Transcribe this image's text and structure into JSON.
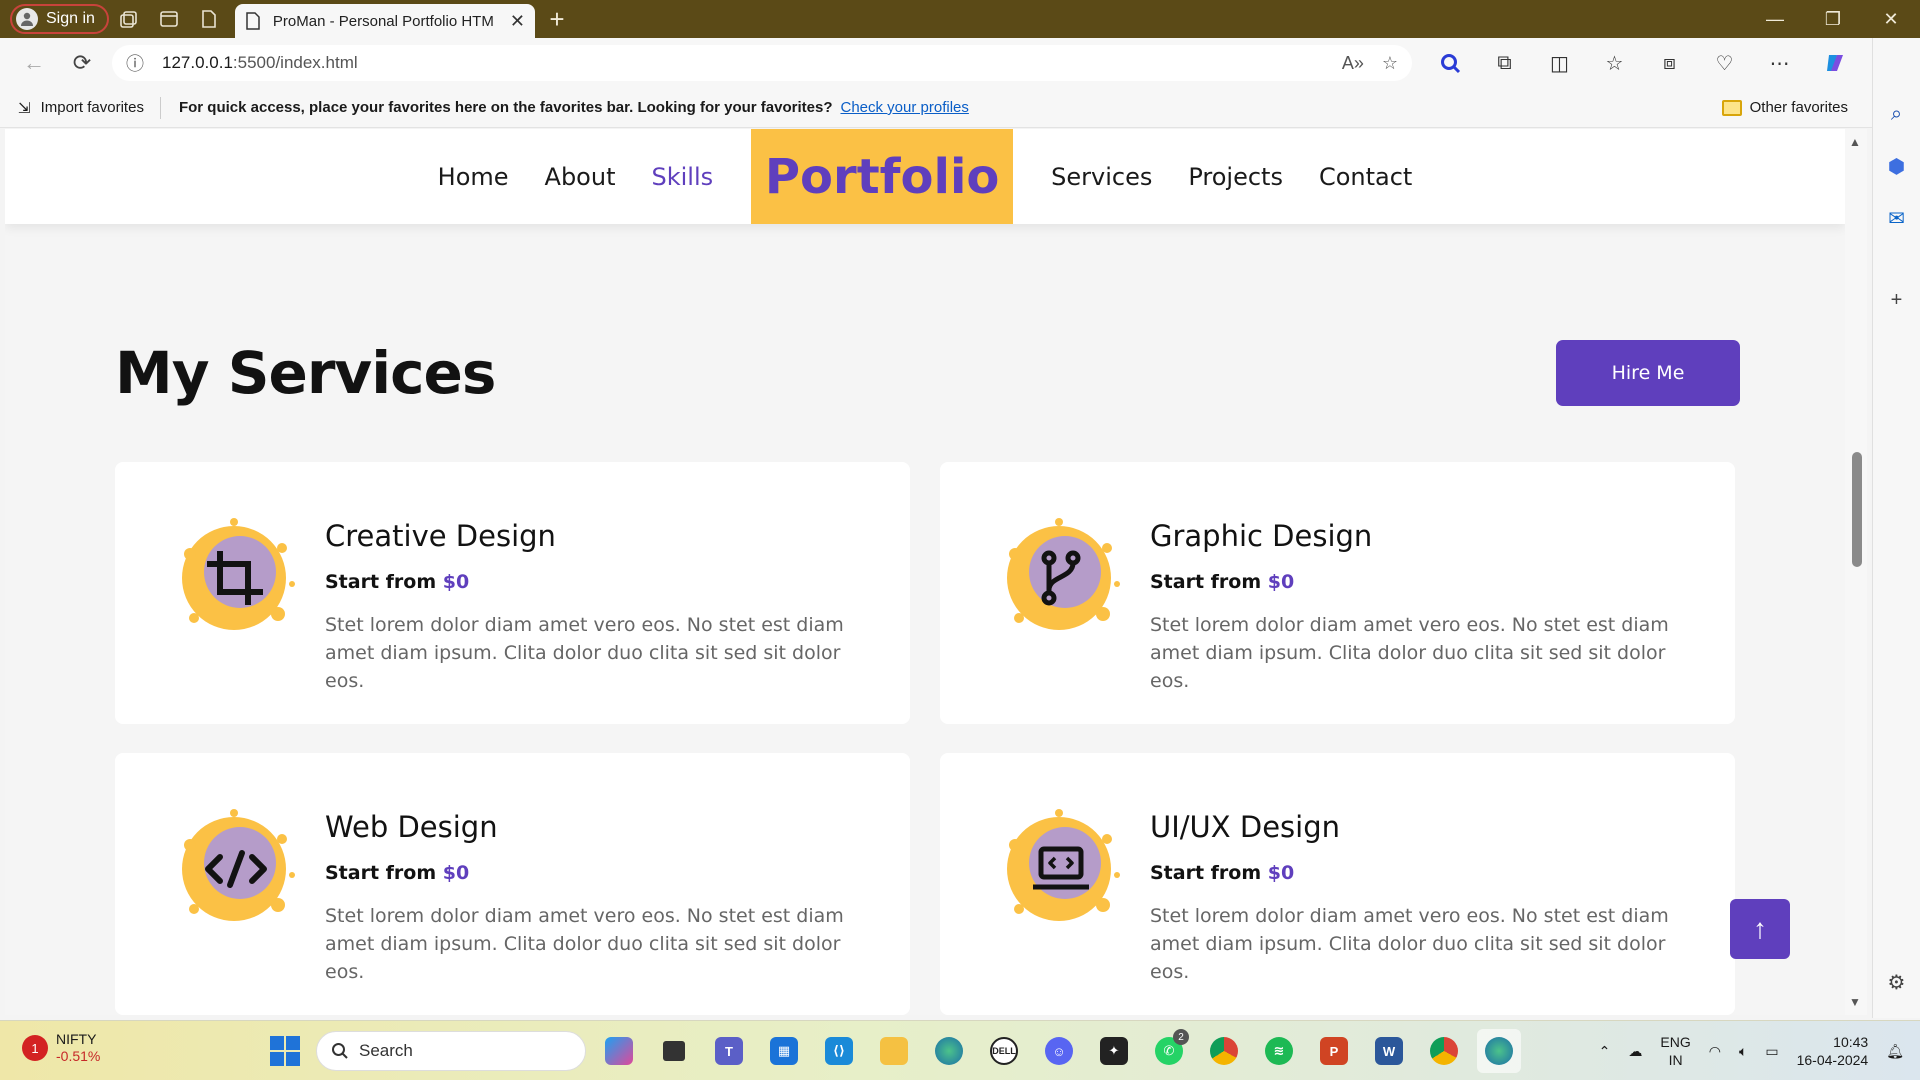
{
  "browser": {
    "signin_label": "Sign in",
    "tab_title": "ProMan - Personal Portfolio HTM",
    "url_host": "127.0.0.1",
    "url_path": ":5500/index.html",
    "favorites_import": "Import favorites",
    "favorites_message": "For quick access, place your favorites here on the favorites bar. Looking for your favorites?",
    "favorites_link": "Check your profiles",
    "favorites_other": "Other favorites"
  },
  "site": {
    "nav_left": [
      "Home",
      "About",
      "Skills"
    ],
    "brand": "Portfolio",
    "nav_right": [
      "Services",
      "Projects",
      "Contact"
    ],
    "active_nav": "Skills"
  },
  "services": {
    "title": "My Services",
    "hire_label": "Hire Me",
    "price_prefix": "Start from",
    "items": [
      {
        "title": "Creative Design",
        "price": "$0",
        "icon": "crop-icon",
        "desc": "Stet lorem dolor diam amet vero eos. No stet est diam amet diam ipsum. Clita dolor duo clita sit sed sit dolor eos."
      },
      {
        "title": "Graphic Design",
        "price": "$0",
        "icon": "code-branch-icon",
        "desc": "Stet lorem dolor diam amet vero eos. No stet est diam amet diam ipsum. Clita dolor duo clita sit sed sit dolor eos."
      },
      {
        "title": "Web Design",
        "price": "$0",
        "icon": "code-icon",
        "desc": "Stet lorem dolor diam amet vero eos. No stet est diam amet diam ipsum. Clita dolor duo clita sit sed sit dolor eos."
      },
      {
        "title": "UI/UX Design",
        "price": "$0",
        "icon": "laptop-code-icon",
        "desc": "Stet lorem dolor diam amet vero eos. No stet est diam amet diam ipsum. Clita dolor duo clita sit sed sit dolor eos."
      }
    ]
  },
  "taskbar": {
    "ticker_name": "NIFTY",
    "ticker_change": "-0.51%",
    "ticker_badge": "1",
    "search_placeholder": "Search",
    "whatsapp_badge": "2",
    "lang_line1": "ENG",
    "lang_line2": "IN",
    "time": "10:43",
    "date": "16-04-2024"
  },
  "colors": {
    "accent": "#5f3fbd",
    "brand_bg": "#fbc145"
  }
}
